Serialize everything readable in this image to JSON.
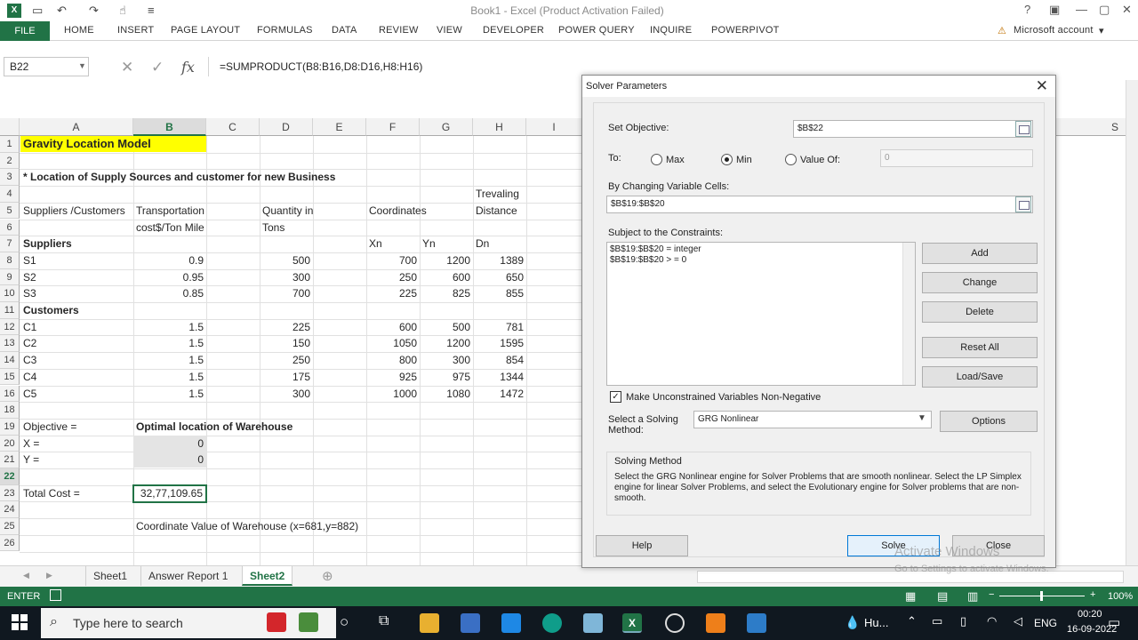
{
  "window": {
    "title": "Book1 - Excel (Product Activation Failed)",
    "account": "Microsoft account"
  },
  "ribbon": {
    "file": "FILE",
    "tabs": [
      "HOME",
      "INSERT",
      "PAGE LAYOUT",
      "FORMULAS",
      "DATA",
      "REVIEW",
      "VIEW",
      "DEVELOPER",
      "POWER QUERY",
      "INQUIRE",
      "POWERPIVOT"
    ]
  },
  "formula_bar": {
    "name_box": "B22",
    "fx": "fx",
    "formula": "=SUMPRODUCT(B8:B16,D8:D16,H8:H16)"
  },
  "columns": [
    "A",
    "B",
    "C",
    "D",
    "E",
    "F",
    "G",
    "H",
    "I"
  ],
  "hidden_col": "S",
  "rows": [
    "1",
    "2",
    "3",
    "4",
    "5",
    "6",
    "7",
    "8",
    "9",
    "10",
    "11",
    "12",
    "13",
    "14",
    "15",
    "16",
    "18",
    "19",
    "20",
    "21",
    "22",
    "23",
    "24",
    "25",
    "26"
  ],
  "sheet": {
    "title": "Gravity Location Model",
    "subtitle": "* Location of Supply Sources and customer for new Business",
    "h4": "Trevaling",
    "h5": [
      "Suppliers /Customers",
      "Transportation",
      "Quantity in",
      "Coordinates",
      "Distance"
    ],
    "h6": [
      "cost$/Ton Mile",
      "Tons"
    ],
    "h7": [
      "Suppliers",
      "Xn",
      "Yn",
      "Dn"
    ],
    "customers_label": "Customers",
    "data_rows": [
      [
        "S1",
        "0.9",
        "500",
        "700",
        "1200",
        "1389"
      ],
      [
        "S2",
        "0.95",
        "300",
        "250",
        "600",
        "650"
      ],
      [
        "S3",
        "0.85",
        "700",
        "225",
        "825",
        "855"
      ],
      [
        "C1",
        "1.5",
        "225",
        "600",
        "500",
        "781"
      ],
      [
        "C2",
        "1.5",
        "150",
        "1050",
        "1200",
        "1595"
      ],
      [
        "C3",
        "1.5",
        "250",
        "800",
        "300",
        "854"
      ],
      [
        "C4",
        "1.5",
        "175",
        "925",
        "975",
        "1344"
      ],
      [
        "C5",
        "1.5",
        "300",
        "1000",
        "1080",
        "1472"
      ]
    ],
    "objective_label": "Objective =",
    "optimal_label": "Optimal location of Warehouse",
    "x_label": "X =",
    "x_value": "0",
    "y_label": "Y =",
    "y_value": "0",
    "total_label": "Total Cost =",
    "total_value": "32,77,109.65",
    "coord_note": "Coordinate Value of Warehouse (x=681,y=882)"
  },
  "sheet_tabs": [
    "Sheet1",
    "Answer Report 1",
    "Sheet2"
  ],
  "status": {
    "mode": "ENTER",
    "zoom": "100%"
  },
  "taskbar": {
    "search_placeholder": "Type here to search",
    "weather": "Hu...",
    "lang": "ENG",
    "time": "00:20",
    "date": "16-09-2022"
  },
  "solver": {
    "title": "Solver Parameters",
    "set_objective_label": "Set Objective:",
    "objective_cell": "$B$22",
    "to_label": "To:",
    "max_label": "Max",
    "min_label": "Min",
    "value_of_label": "Value Of:",
    "value_of": "0",
    "changing_label": "By Changing Variable Cells:",
    "changing_cells": "$B$19:$B$20",
    "subject_label": "Subject to the Constraints:",
    "constraints": [
      "$B$19:$B$20 = integer",
      "$B$19:$B$20 > = 0"
    ],
    "buttons": {
      "add": "Add",
      "change": "Change",
      "delete": "Delete",
      "reset_all": "Reset All",
      "load_save": "Load/Save",
      "options": "Options",
      "help": "Help",
      "solve": "Solve",
      "close": "Close"
    },
    "nonneg_label": "Make Unconstrained Variables Non-Negative",
    "method_label_1": "Select a Solving",
    "method_label_2": "Method:",
    "method": "GRG Nonlinear",
    "method_group": "Solving Method",
    "method_text": "Select the GRG Nonlinear engine for Solver Problems that are smooth nonlinear. Select the LP Simplex engine for linear Solver Problems, and select the Evolutionary engine for Solver problems that are non-smooth."
  },
  "watermark": {
    "line1": "Activate Windows",
    "line2": "Go to Settings to activate Windows."
  }
}
